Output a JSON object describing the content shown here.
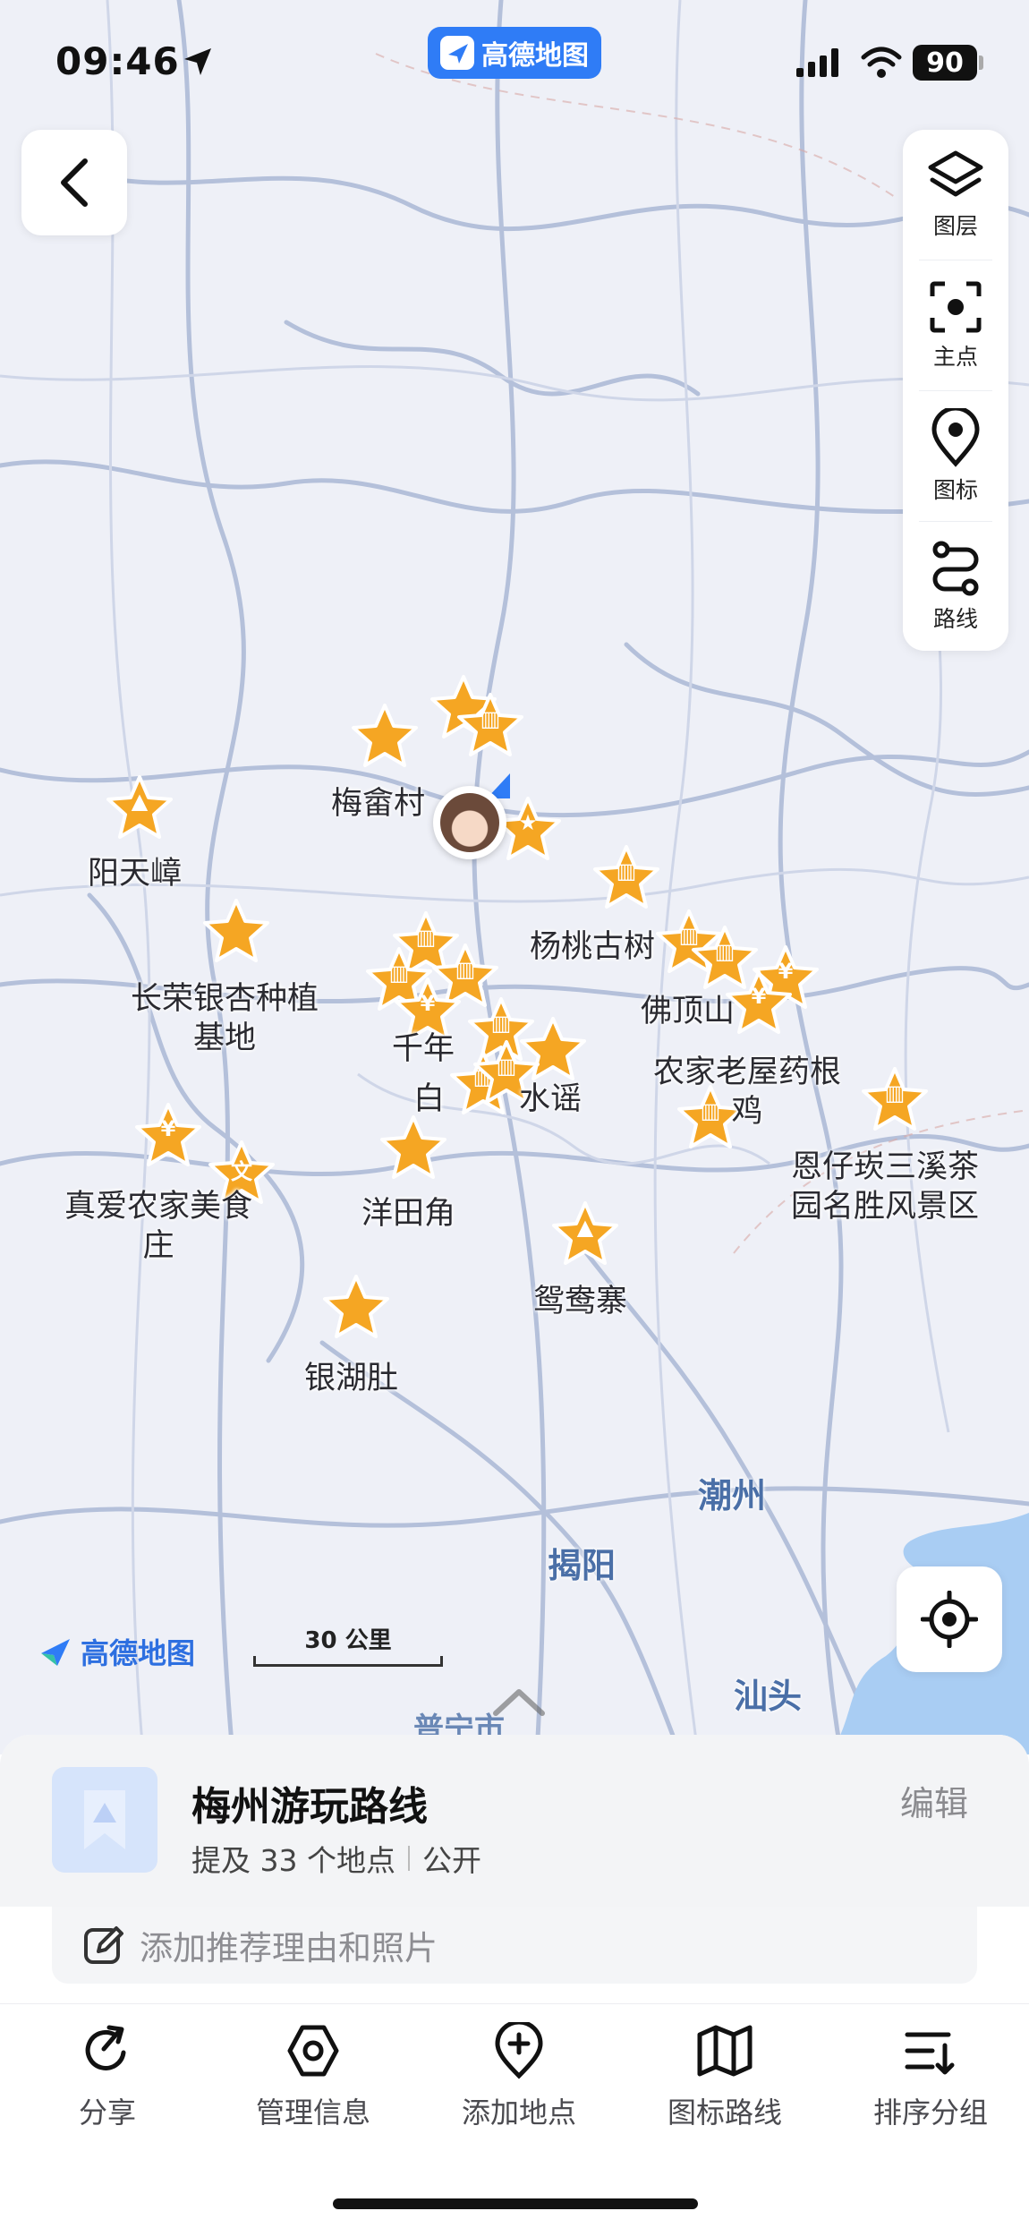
{
  "status_bar": {
    "time": "09:46",
    "app_badge": "高德地图",
    "battery": "90"
  },
  "map": {
    "cities": [
      {
        "name": "潮州",
        "key": "chaozhou"
      },
      {
        "name": "揭阳",
        "key": "jieyang"
      },
      {
        "name": "汕头",
        "key": "shantou"
      },
      {
        "name": "普宁市",
        "key": "puning"
      }
    ],
    "poi_labels": {
      "meishe": "梅畲村",
      "yangtian": "阳天嶂",
      "changrong": "长荣银杏种植\n基地",
      "yangtao": "杨桃古树",
      "foding": "佛顶山",
      "nongjia": "农家老屋药根\n鸡",
      "enzai": "恩仔崁三溪茶\n园名胜风景区",
      "zhenai": "真爱农家美食\n庄",
      "yangtian_jiao": "洋田角",
      "yuanyang": "鸳鸯寨",
      "yinhu": "银湖肚",
      "qiannian": "千年",
      "baishui": "白",
      "shuiyao": "水谣"
    },
    "logo_text": "高德地图",
    "scale_text": "30 公里",
    "tools": [
      {
        "label": "图层",
        "icon": "layers-icon"
      },
      {
        "label": "主点",
        "icon": "focus-icon"
      },
      {
        "label": "图标",
        "icon": "pin-icon"
      },
      {
        "label": "路线",
        "icon": "route-icon"
      }
    ],
    "colors": {
      "poi": "#f5a623",
      "poi_stroke": "#ffffff",
      "road": "#a9b6d3",
      "map_bg": "#eef0f7",
      "sea": "#a9cdf3"
    }
  },
  "route": {
    "title": "梅州游玩路线",
    "place_count_text": "提及 33 个地点",
    "visibility": "公开",
    "edit_label": "编辑",
    "reason_placeholder": "添加推荐理由和照片"
  },
  "bottom_bar": [
    {
      "label": "分享",
      "icon": "share-icon"
    },
    {
      "label": "管理信息",
      "icon": "manage-icon"
    },
    {
      "label": "添加地点",
      "icon": "add-place-icon"
    },
    {
      "label": "图标路线",
      "icon": "map-route-icon"
    },
    {
      "label": "排序分组",
      "icon": "sort-icon"
    }
  ]
}
